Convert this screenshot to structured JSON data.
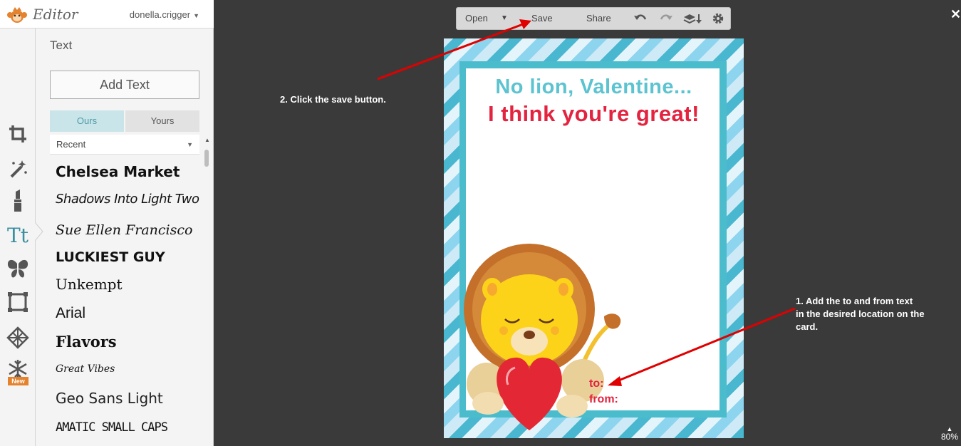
{
  "app": {
    "name": "Editor",
    "user": "donella.crigger"
  },
  "panel": {
    "title": "Text",
    "add_text_label": "Add Text",
    "tabs": [
      "Ours",
      "Yours"
    ],
    "filter_label": "Recent",
    "fonts": [
      "Chelsea Market",
      "Shadows Into Light Two",
      "Sue Ellen Francisco",
      "Luckiest Guy",
      "Unkempt",
      "Arial",
      "Flavors",
      "Great Vibes",
      "Geo Sans Light",
      "Amatic Small Caps"
    ]
  },
  "tools": {
    "text_tool_label": "Tt",
    "new_badge": "New"
  },
  "toolbar": {
    "open_label": "Open",
    "save_label": "Save",
    "share_label": "Share"
  },
  "card": {
    "line1": "No lion, Valentine...",
    "line2": "I think you're great!",
    "to_label": "to:",
    "from_label": "from:"
  },
  "annotations": {
    "step2": "2. Click the save button.",
    "step1_line1": "1. Add the to and from text",
    "step1_line2": "in the desired location on the",
    "step1_line3": "card."
  },
  "zoom": {
    "level": "80%"
  },
  "colors": {
    "accent": "#4bbccc",
    "card_red": "#e3233f",
    "card_teal": "#5cc3d0",
    "arrow": "#e00000"
  }
}
